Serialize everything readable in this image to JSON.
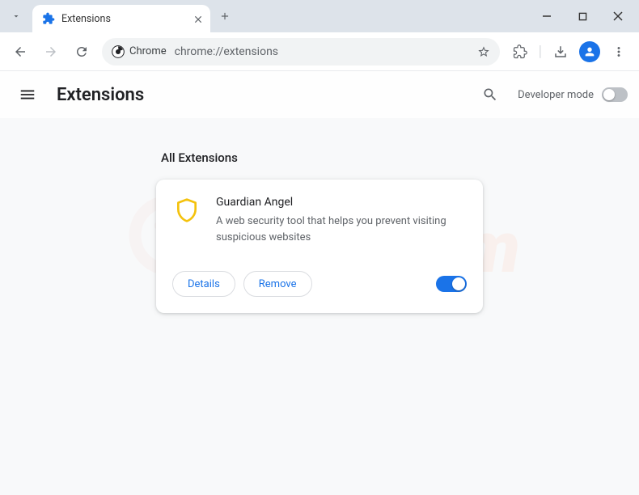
{
  "tab": {
    "title": "Extensions"
  },
  "omnibox": {
    "scheme_label": "Chrome",
    "url": "chrome://extensions"
  },
  "page": {
    "title": "Extensions",
    "developer_mode_label": "Developer mode",
    "developer_mode_on": false
  },
  "section": {
    "heading": "All Extensions"
  },
  "extensions": [
    {
      "name": "Guardian Angel",
      "description": "A web security tool that helps you prevent visiting suspicious websites",
      "icon": "shield-yellow",
      "enabled": true,
      "buttons": {
        "details": "Details",
        "remove": "Remove"
      }
    }
  ]
}
